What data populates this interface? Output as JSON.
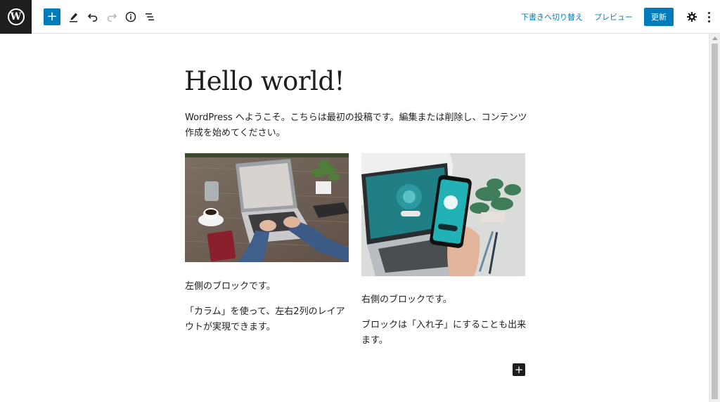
{
  "toolbar": {
    "add_block": "+",
    "switch_to_draft": "下書きへ切り替え",
    "preview": "プレビュー",
    "update": "更新"
  },
  "post": {
    "title": "Hello world!",
    "intro": "WordPress へようこそ。こちらは最初の投稿です。編集または削除し、コンテンツ作成を始めてください。"
  },
  "columns": {
    "left": {
      "image_alt": "laptop-typing-on-wooden-desk-photo",
      "paragraphs": [
        "左側のブロックです。",
        "「カラム」を使って、左右2列のレイアウトが実現できます。"
      ]
    },
    "right": {
      "image_alt": "smartphone-app-with-laptop-photo",
      "paragraphs": [
        "右側のブロックです。",
        "ブロックは「入れ子」にすることも出来ます。"
      ]
    }
  },
  "inserter": {
    "label": "+"
  },
  "colors": {
    "accent": "#007cba",
    "dark": "#1e1e1e"
  }
}
